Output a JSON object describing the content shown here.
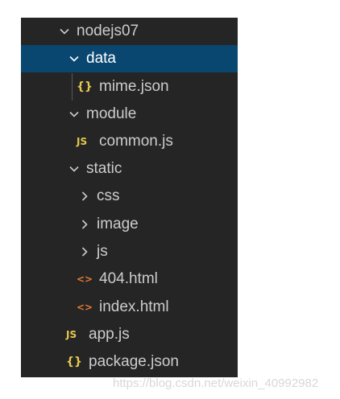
{
  "explorer": {
    "items": [
      {
        "label": "nodejs07",
        "kind": "folder-open"
      },
      {
        "label": "data",
        "kind": "folder-open"
      },
      {
        "label": "mime.json",
        "kind": "json",
        "icon": "{}"
      },
      {
        "label": "module",
        "kind": "folder-open"
      },
      {
        "label": "common.js",
        "kind": "js",
        "icon": "JS"
      },
      {
        "label": "static",
        "kind": "folder-open"
      },
      {
        "label": "css",
        "kind": "folder-closed"
      },
      {
        "label": "image",
        "kind": "folder-closed"
      },
      {
        "label": "js",
        "kind": "folder-closed"
      },
      {
        "label": "404.html",
        "kind": "html",
        "icon": "<>"
      },
      {
        "label": "index.html",
        "kind": "html",
        "icon": "<>"
      },
      {
        "label": "app.js",
        "kind": "js",
        "icon": "JS"
      },
      {
        "label": "package.json",
        "kind": "json",
        "icon": "{}"
      }
    ],
    "selected": "data"
  },
  "watermark": "https://blog.csdn.net/weixin_40992982",
  "colors": {
    "panel_bg": "#252526",
    "selected_bg": "#094771",
    "text": "#cccccc",
    "js_icon": "#e6c94d",
    "json_icon": "#e6c94d",
    "html_icon": "#e37933"
  }
}
